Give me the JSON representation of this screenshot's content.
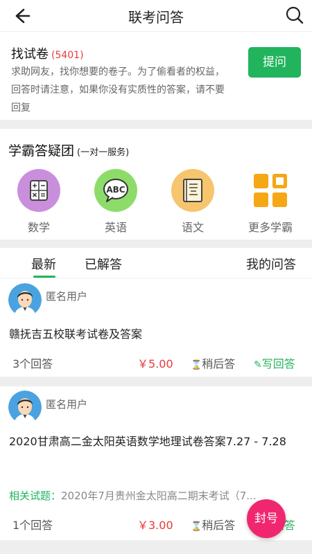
{
  "header": {
    "title": "联考问答",
    "back_icon": "arrow-left-icon",
    "search_icon": "search-icon"
  },
  "find_paper": {
    "title": "找试卷",
    "count": "(5401)",
    "description": "求助网友，找你想要的卷子。为了偷看者的权益，回答时请注意，如果你没有实质性的答案，请不要回复",
    "ask_button": "提问"
  },
  "study_team": {
    "title": "学霸答疑团",
    "subtitle": "(一对一服务)",
    "subjects": [
      {
        "label": "数学",
        "icon": "calculator-icon",
        "color": "#c98fdc"
      },
      {
        "label": "英语",
        "icon": "abc-chat-icon",
        "color": "#8ddc6a"
      },
      {
        "label": "语文",
        "icon": "book-icon",
        "color": "#f6c56d"
      },
      {
        "label": "更多学霸",
        "icon": "grid-icon",
        "color": "#f5a716"
      }
    ]
  },
  "tabs": {
    "latest": "最新",
    "answered": "已解答",
    "mine": "我的问答",
    "active": "最新"
  },
  "questions": [
    {
      "user": "匿名用户",
      "title": "赣抚吉五校联考试卷及答案",
      "answers": "3个回答",
      "reward": "￥5.00",
      "answer_later": "稍后答",
      "write_answer": "写回答"
    },
    {
      "user": "匿名用户",
      "title": "2020甘肃高二金太阳英语数学地理试卷答案7.27 - 7.28",
      "related_label": "相关试题：",
      "related_text": "2020年7月贵州金太阳高二期末考试（7...",
      "answers": "1个回答",
      "reward": "￥3.00",
      "answer_later": "稍后答",
      "write_answer": "写回答"
    }
  ],
  "fab": {
    "label": "封号"
  },
  "colors": {
    "accent": "#21b45c",
    "price": "#e63a3a",
    "fab": "#f0266e"
  }
}
